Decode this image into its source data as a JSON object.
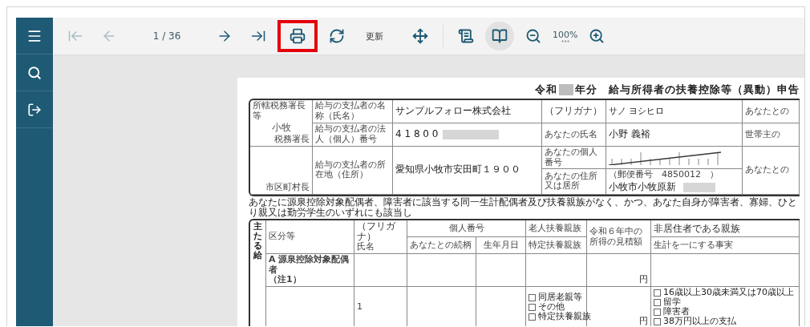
{
  "toolbar": {
    "navigation": [
      {
        "kind": "first",
        "disabled": true
      },
      {
        "kind": "prev",
        "disabled": true
      },
      {
        "kind": "next",
        "disabled": false
      },
      {
        "kind": "last",
        "disabled": false
      }
    ],
    "page_indicator": "1 / 36",
    "actions": [
      {
        "kind": "print",
        "highlighted": true
      },
      {
        "kind": "refresh",
        "highlighted": false
      }
    ],
    "refresh_label": "更新",
    "views": [
      {
        "kind": "scroll",
        "selected": false
      },
      {
        "kind": "book",
        "selected": true
      }
    ],
    "zoom": "100%"
  },
  "document": {
    "title_prefix": "令和",
    "title_suffix": "年分　給与所得者の扶養控除等（異動）申告",
    "office": {
      "heading": "所轄税務署長等",
      "name": "小牧",
      "tax_office_label": "税務署長",
      "municipality_label": "市区町村長"
    },
    "payer_rows": [
      {
        "label": "給与の支払者の名称（氏名）",
        "value": "サンプルフォロー株式会社",
        "redacted": false
      },
      {
        "label": "給与の支払者の法人（個人）番号",
        "value": "4 1 8 0 0",
        "redacted": true
      },
      {
        "label": "給与の支払者の所在地（住所）",
        "value": "愛知県小牧市安田町１９００",
        "redacted": false
      }
    ],
    "person_rows": [
      {
        "label": "（フリガナ）",
        "value": "サノ ヨシヒロ",
        "redacted": false
      },
      {
        "label": "あなたの氏名",
        "value": "小野 義裕",
        "redacted": false
      },
      {
        "label": "あなたの個人番号"
      },
      {
        "label": "あなたの住所又は居所",
        "postal": "（郵便番号　4850012　）",
        "value": "小牧市小牧原新",
        "redacted": true
      }
    ],
    "side_labels": [
      "あなたとの",
      "世帯主の",
      "あなたとの"
    ],
    "notice": "あなたに源泉控除対象配偶者、障害者に該当する同一生計配偶者及び扶養親族がなく、かつ、あなた自身が障害者、寡婦、ひとり親又は勤労学生のいずれにも該当し",
    "dependents": {
      "section_label": "主たる給",
      "headers": {
        "category": "区分等",
        "furigana": "（フリガナ）",
        "name": "氏名",
        "number": "個人番号",
        "relation": "あなたとの続柄",
        "birth": "生年月日",
        "elderly": "老人扶養親族",
        "special": "特定扶養親族",
        "income": "令和６年中の所得の見積額",
        "nonresident": "非居住者である親族",
        "household": "生計を一にする事実"
      },
      "spouse": {
        "mark": "A",
        "label": "源泉控除対象配偶者",
        "note": "（注1）",
        "unit": "円"
      },
      "rows": [
        {
          "number": "1",
          "options": [
            {
              "label": "同居老親等",
              "checked": false
            },
            {
              "label": "その他",
              "checked": false
            }
          ],
          "special_option": {
            "label": "特定扶養親族",
            "checked": false
          },
          "unit": "円",
          "nonresident_options": [
            {
              "label": "16歳以上30歳未満又は70歳以上",
              "checked": false
            },
            {
              "label": "留学",
              "checked": false
            },
            {
              "label": "障害者",
              "checked": false
            },
            {
              "label": "38万円以上の支払",
              "checked": false
            }
          ]
        }
      ]
    }
  }
}
